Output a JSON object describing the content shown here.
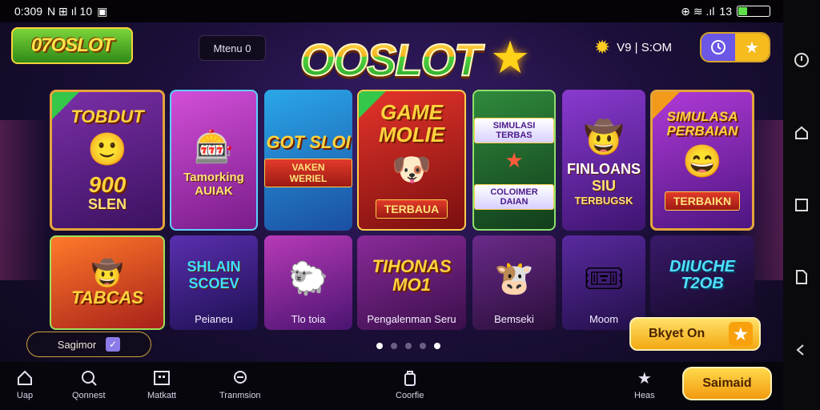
{
  "status_bar": {
    "time": "0:309",
    "indicators": "N ⊞ ıl 10",
    "right_icons": "⊕ ≋ .ıl",
    "battery_label": "13",
    "battery_level": 0.3,
    "battery_color": "#5fe04a"
  },
  "header": {
    "small_logo": "07OSLOT",
    "menu_chip": "Mtenu 0",
    "main_logo": "OOSLOT",
    "timer_text": "V9 | S:OM"
  },
  "cards_row1": [
    {
      "title": "TOBDUT",
      "subtitle": "900",
      "badge": "SLEN"
    },
    {
      "title": "",
      "subtitle": "Tamorking AUIAK",
      "badge": ""
    },
    {
      "title": "GOT SLOI",
      "subtitle": "",
      "badge": "VAKEN WERIEL"
    },
    {
      "title": "GAME MOLIE",
      "subtitle": "",
      "badge": "TERBAUA"
    },
    {
      "title": "SIMULASI TERBAS",
      "subtitle": "",
      "badge": "COLOIMER DAIAN"
    },
    {
      "title": "FINLOANS",
      "subtitle": "SIU",
      "badge": "TERBUGSK"
    },
    {
      "title": "SIMULASA PERBAIAN",
      "subtitle": "",
      "badge": "TERBAIKN"
    }
  ],
  "cards_row2": [
    {
      "title": "TABCAS",
      "caption": ""
    },
    {
      "title": "SHLAIN SCOEV",
      "caption": "Peianeu"
    },
    {
      "title": "",
      "caption": "Tlo toia"
    },
    {
      "title": "TIHONAS MO1",
      "caption": "Pengalenman Seru"
    },
    {
      "title": "",
      "caption": "Bemseki"
    },
    {
      "title": "",
      "caption": "Moom"
    },
    {
      "title": "DIIUCHE T2OB",
      "caption": ""
    }
  ],
  "search_chip": {
    "label": "Sagimor"
  },
  "pager": {
    "count": 5,
    "active": [
      0,
      4
    ]
  },
  "play_button": {
    "label": "Bkyet On"
  },
  "bottom_nav": [
    {
      "label": "Uap",
      "icon": "home-icon"
    },
    {
      "label": "Qonnest",
      "icon": "search-icon"
    },
    {
      "label": "Matkatt",
      "icon": "grid-icon"
    },
    {
      "label": "Tranmsion",
      "icon": "chat-icon"
    },
    {
      "label": "Coorfie",
      "icon": "bag-icon"
    },
    {
      "label": "Heas",
      "icon": "star-icon"
    }
  ],
  "cta_button": {
    "label": "Saimaid"
  },
  "colors": {
    "gold": "#f6bb1c",
    "purple": "#6b57e6",
    "green": "#35c74a"
  }
}
